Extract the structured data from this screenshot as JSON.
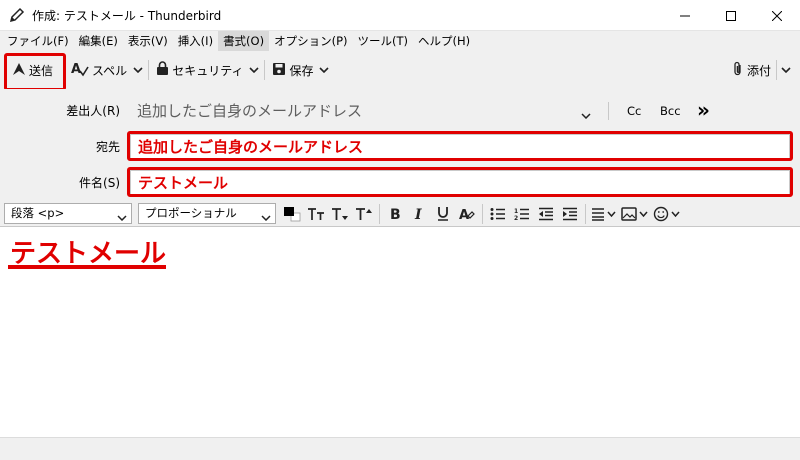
{
  "window": {
    "title": "作成: テストメール - Thunderbird"
  },
  "menu": [
    {
      "label": "ファイル(F)"
    },
    {
      "label": "編集(E)"
    },
    {
      "label": "表示(V)"
    },
    {
      "label": "挿入(I)"
    },
    {
      "label": "書式(O)"
    },
    {
      "label": "オプション(P)"
    },
    {
      "label": "ツール(T)"
    },
    {
      "label": "ヘルプ(H)"
    }
  ],
  "toolbar": {
    "send": "送信",
    "spell": "スペル",
    "security": "セキュリティ",
    "save": "保存",
    "attach": "添付"
  },
  "headers": {
    "from_label": "差出人(R)",
    "from_value": "追加したご自身のメールアドレス",
    "cc": "Cc",
    "bcc": "Bcc",
    "more": "»",
    "to_label": "宛先",
    "to_value": "追加したご自身のメールアドレス",
    "subject_label": "件名(S)",
    "subject_value": "テストメール"
  },
  "format": {
    "paragraph": "段落 <p>",
    "font": "プロポーショナル"
  },
  "body": {
    "text": "テストメール"
  },
  "colors": {
    "highlight": "#e00000",
    "chrome": "#f0f0f0"
  }
}
